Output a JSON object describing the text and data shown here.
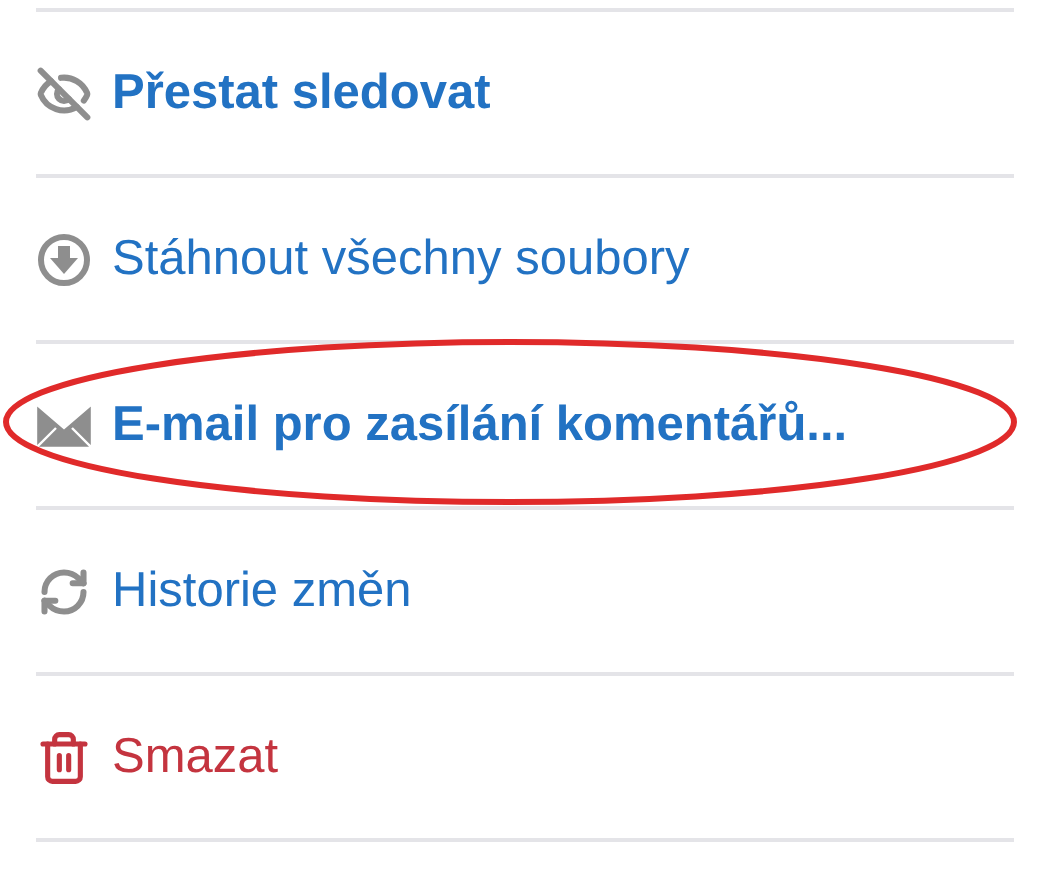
{
  "menu": {
    "items": [
      {
        "label": "Přestat sledovat",
        "kind": "normal",
        "bold": true,
        "highlighted": false
      },
      {
        "label": "Stáhnout všechny soubory",
        "kind": "normal",
        "bold": false,
        "highlighted": false
      },
      {
        "label": "E-mail pro zasílání komentářů...",
        "kind": "normal",
        "bold": true,
        "highlighted": true
      },
      {
        "label": "Historie změn",
        "kind": "normal",
        "bold": false,
        "highlighted": false
      },
      {
        "label": "Smazat",
        "kind": "danger",
        "bold": false,
        "highlighted": false
      }
    ]
  }
}
